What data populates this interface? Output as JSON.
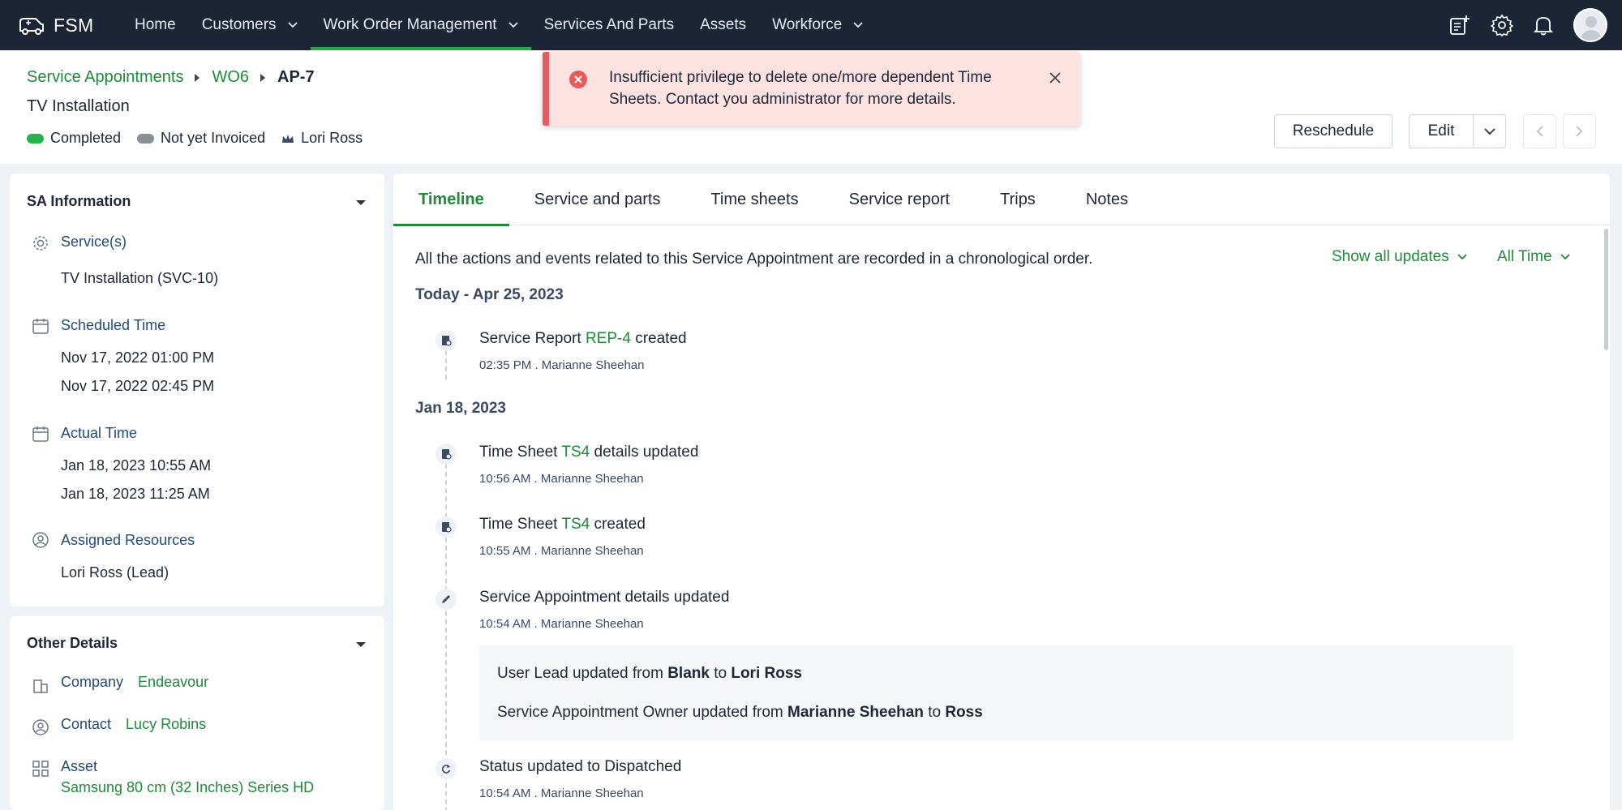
{
  "nav": {
    "brand": "FSM",
    "items": [
      {
        "label": "Home",
        "dropdown": false
      },
      {
        "label": "Customers",
        "dropdown": true
      },
      {
        "label": "Work Order Management",
        "dropdown": true
      },
      {
        "label": "Services And Parts",
        "dropdown": false
      },
      {
        "label": "Assets",
        "dropdown": false
      },
      {
        "label": "Workforce",
        "dropdown": true
      }
    ],
    "active_item": "Work Order Management"
  },
  "breadcrumb": [
    "Service Appointments",
    "WO6",
    "AP-7"
  ],
  "page_title": "TV Installation",
  "status": {
    "completed": {
      "label": "Completed",
      "color": "#27b34a"
    },
    "invoice": {
      "label": "Not yet Invoiced",
      "color": "#8a8f96"
    },
    "owner": "Lori Ross"
  },
  "actions": {
    "reschedule": "Reschedule",
    "edit": "Edit"
  },
  "toast": {
    "message": "Insufficient privilege to delete one/more dependent Time Sheets. Contact you administrator for more details."
  },
  "sa_info": {
    "title": "SA Information",
    "services_label": "Service(s)",
    "services_value": "TV Installation (SVC-10)",
    "scheduled_label": "Scheduled Time",
    "scheduled_start": "Nov 17, 2022 01:00 PM",
    "scheduled_end": "Nov 17, 2022 02:45 PM",
    "actual_label": "Actual Time",
    "actual_start": "Jan 18, 2023 10:55 AM",
    "actual_end": "Jan 18, 2023 11:25 AM",
    "resources_label": "Assigned Resources",
    "resources_value": "Lori Ross (Lead)"
  },
  "other_details": {
    "title": "Other Details",
    "company_label": "Company",
    "company_value": "Endeavour",
    "contact_label": "Contact",
    "contact_value": "Lucy Robins",
    "asset_label": "Asset",
    "asset_value": "Samsung 80 cm (32 Inches) Series HD"
  },
  "tabs": [
    "Timeline",
    "Service and parts",
    "Time sheets",
    "Service report",
    "Trips",
    "Notes"
  ],
  "active_tab": "Timeline",
  "timeline": {
    "intro": "All the actions and events related to this Service Appointment are recorded in a chronological order.",
    "filter_updates": "Show all updates",
    "filter_time": "All Time",
    "group1_date": "Today - Apr 25, 2023",
    "group2_date": "Jan 18, 2023",
    "events": [
      {
        "prefix": "Service Report ",
        "link": "REP-4",
        "suffix": " created",
        "meta": "02:35 PM . Marianne Sheehan",
        "icon": "report-icon"
      },
      {
        "prefix": "Time Sheet ",
        "link": "TS4",
        "suffix": " details updated",
        "meta": "10:56 AM . Marianne Sheehan",
        "icon": "timesheet-icon"
      },
      {
        "prefix": "Time Sheet ",
        "link": "TS4",
        "suffix": " created",
        "meta": "10:55 AM . Marianne Sheehan",
        "icon": "timesheet-icon"
      },
      {
        "prefix": "Service Appointment details updated",
        "link": "",
        "suffix": "",
        "meta": "10:54 AM . Marianne Sheehan",
        "icon": "pencil-icon"
      },
      {
        "prefix": "Status updated to Dispatched",
        "link": "",
        "suffix": "",
        "meta": "10:54 AM . Marianne Sheehan",
        "icon": "refresh-icon"
      }
    ],
    "details": [
      {
        "text1": "User Lead updated from ",
        "bold1": "Blank",
        "text2": " to ",
        "bold2": "Lori Ross"
      },
      {
        "text1": "Service Appointment Owner updated from ",
        "bold1": "Marianne Sheehan",
        "text2": " to ",
        "bold2": "Ross"
      }
    ]
  },
  "colors": {
    "nav_bg": "#1c2536",
    "accent_green": "#1e8a3a",
    "toast_bg": "#fde2e2",
    "toast_border": "#e95a5a"
  }
}
